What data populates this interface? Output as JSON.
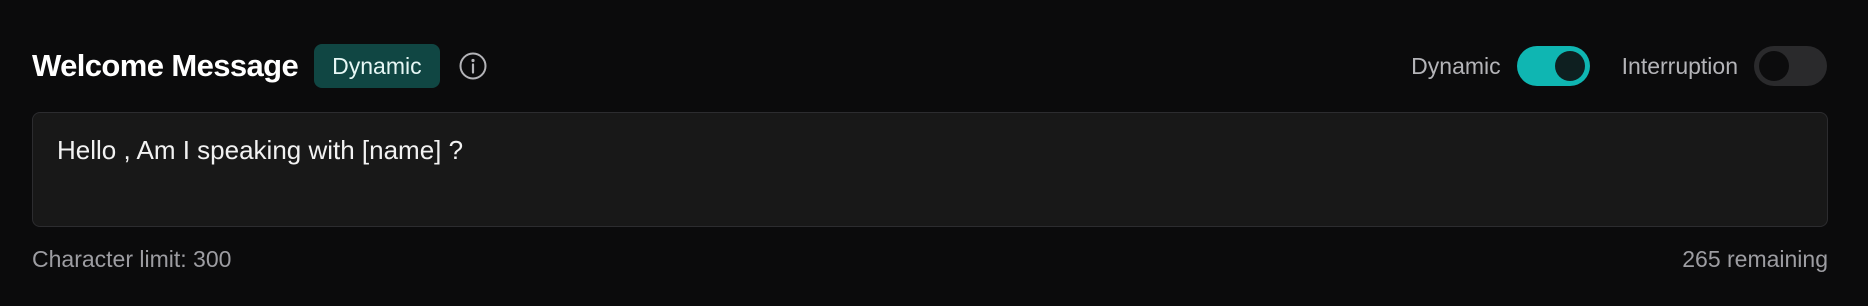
{
  "section": {
    "title": "Welcome Message",
    "badge": "Dynamic",
    "info_icon": "info-icon"
  },
  "toggles": [
    {
      "label": "Dynamic",
      "on": true
    },
    {
      "label": "Interruption",
      "on": false
    }
  ],
  "message": {
    "text": "Hello , Am I speaking with [name] ?"
  },
  "footer": {
    "limit_text": "Character limit: 300",
    "remaining_text": "265 remaining"
  },
  "colors": {
    "background": "#0b0b0c",
    "accent": "#0fb6b2",
    "badge_bg": "#104643"
  }
}
